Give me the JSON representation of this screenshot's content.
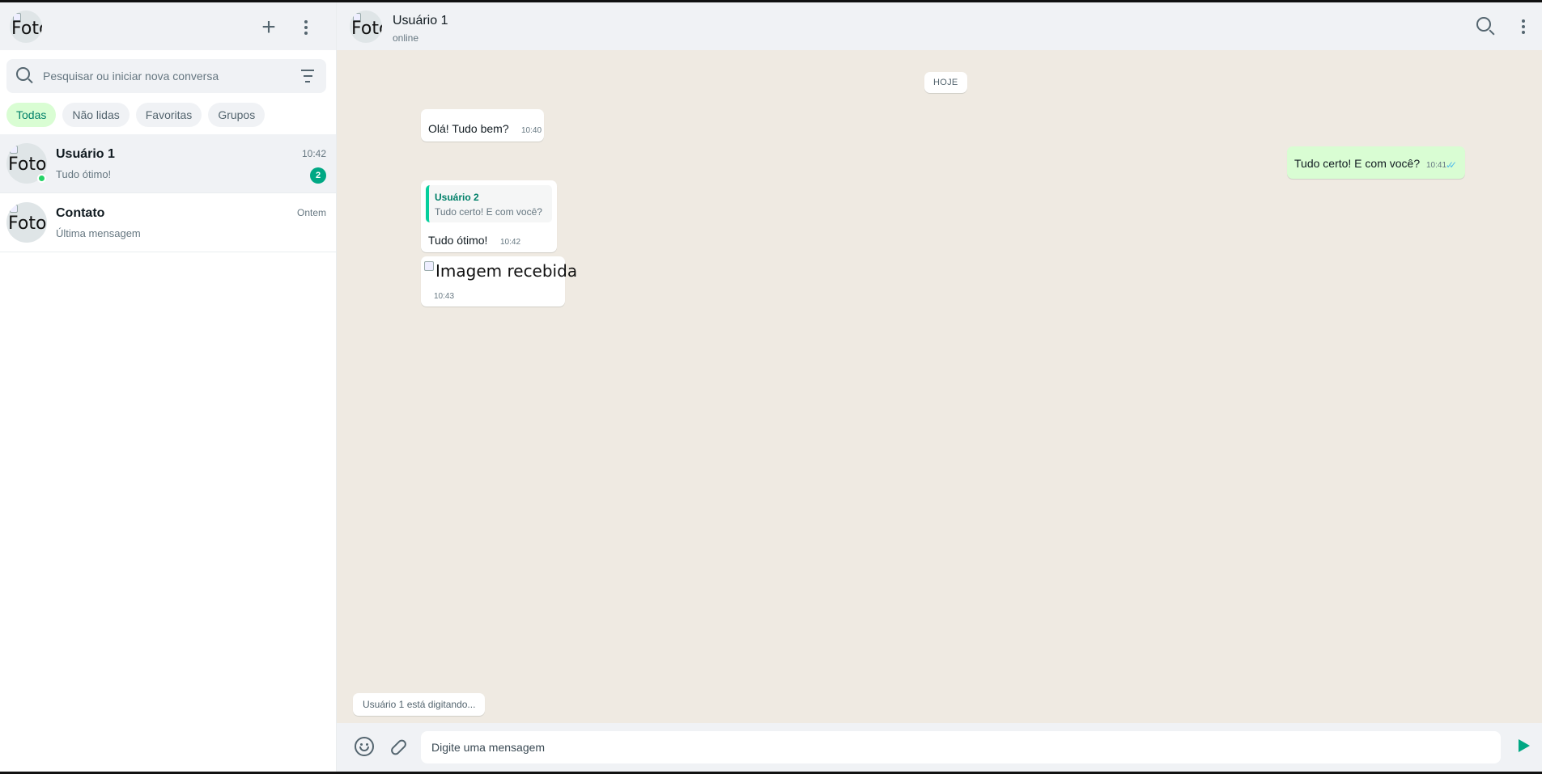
{
  "sidebar": {
    "profile_avatar_alt": "Foto",
    "new_chat_icon": "plus-icon",
    "menu_icon": "kebab-menu-icon",
    "search": {
      "placeholder": "Pesquisar ou iniciar nova conversa",
      "value": ""
    },
    "filters": [
      {
        "label": "Todas",
        "active": true
      },
      {
        "label": "Não lidas",
        "active": false
      },
      {
        "label": "Favoritas",
        "active": false
      },
      {
        "label": "Grupos",
        "active": false
      }
    ],
    "chats": [
      {
        "avatar_alt": "Foto",
        "name": "Usuário 1",
        "last_message": "Tudo ótimo!",
        "time": "10:42",
        "unread": "2",
        "online": true,
        "selected": true
      },
      {
        "avatar_alt": "Foto",
        "name": "Contato",
        "last_message": "Última mensagem",
        "time": "Ontem",
        "unread": "",
        "online": false,
        "selected": false
      }
    ]
  },
  "conversation": {
    "avatar_alt": "Foto",
    "title": "Usuário 1",
    "status": "online",
    "day_separator": "HOJE",
    "messages": [
      {
        "direction": "in",
        "text": "Olá! Tudo bem?",
        "time": "10:40"
      },
      {
        "direction": "out",
        "text": "Tudo certo! E com você?",
        "time": "10:41",
        "ticks": "✓✓"
      },
      {
        "direction": "in",
        "reply_to": {
          "name": "Usuário 2",
          "text": "Tudo certo! E com você?"
        },
        "text": "Tudo ótimo!",
        "time": "10:42"
      },
      {
        "direction": "in",
        "image_alt": "Imagem recebida",
        "time": "10:43"
      }
    ],
    "typing_indicator": "Usuário 1 está digitando...",
    "composer": {
      "placeholder": "Digite uma mensagem",
      "value": ""
    }
  },
  "colors": {
    "accent": "#00a884",
    "chat_bg": "#efeae2",
    "outgoing_bubble": "#d9fdd3",
    "panel_bg": "#f0f2f5",
    "read_ticks": "#53bdeb"
  }
}
